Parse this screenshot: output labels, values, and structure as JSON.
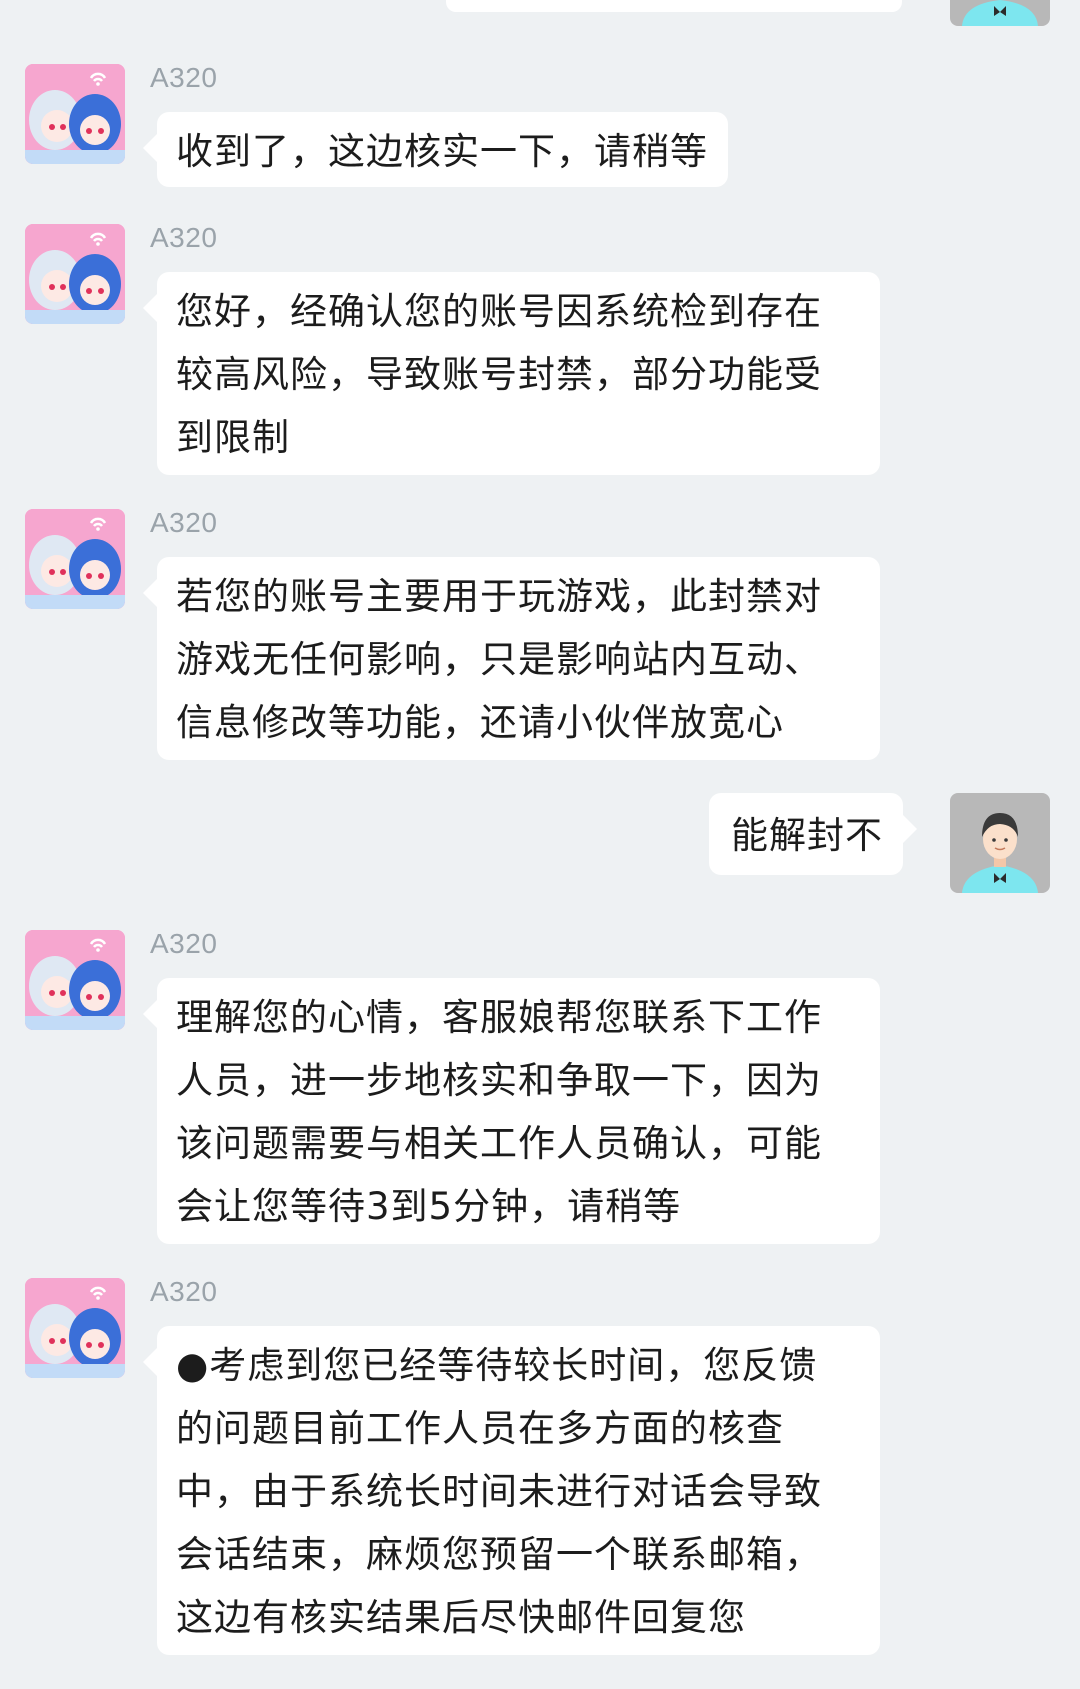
{
  "colors": {
    "background": "#eef1f3",
    "bubble": "#ffffff",
    "sender_name": "#9aa3aa",
    "text": "#1c1c1c",
    "user_avatar_bg": "#b8b8b8",
    "user_avatar_shirt": "#7de6ef",
    "agent_avatar_bg": "#f6a6cf"
  },
  "icons": {
    "agent_avatar": "anime-duo-avatar-icon",
    "user_avatar": "default-user-avatar-icon"
  },
  "messages": [
    {
      "direction": "in",
      "sender": "A320",
      "lines": [
        "收到了，这边核实一下，请稍等"
      ]
    },
    {
      "direction": "in",
      "sender": "A320",
      "lines": [
        "您好，经确认您的账号因系统检到存在",
        "较高风险，导致账号封禁，部分功能受",
        "到限制"
      ]
    },
    {
      "direction": "in",
      "sender": "A320",
      "lines": [
        "若您的账号主要用于玩游戏，此封禁对",
        "游戏无任何影响，只是影响站内互动、",
        "信息修改等功能，还请小伙伴放宽心"
      ]
    },
    {
      "direction": "out",
      "lines": [
        "能解封不"
      ]
    },
    {
      "direction": "in",
      "sender": "A320",
      "lines": [
        "理解您的心情，客服娘帮您联系下工作",
        "人员，进一步地核实和争取一下，因为",
        "该问题需要与相关工作人员确认，可能",
        "会让您等待3到5分钟，请稍等"
      ]
    },
    {
      "direction": "in",
      "sender": "A320",
      "lines": [
        "●考虑到您已经等待较长时间，您反馈",
        "的问题目前工作人员在多方面的核查",
        "中，由于系统长时间未进行对话会导致",
        "会话结束，麻烦您预留一个联系邮箱，",
        "这边有核实结果后尽快邮件回复您"
      ]
    }
  ]
}
